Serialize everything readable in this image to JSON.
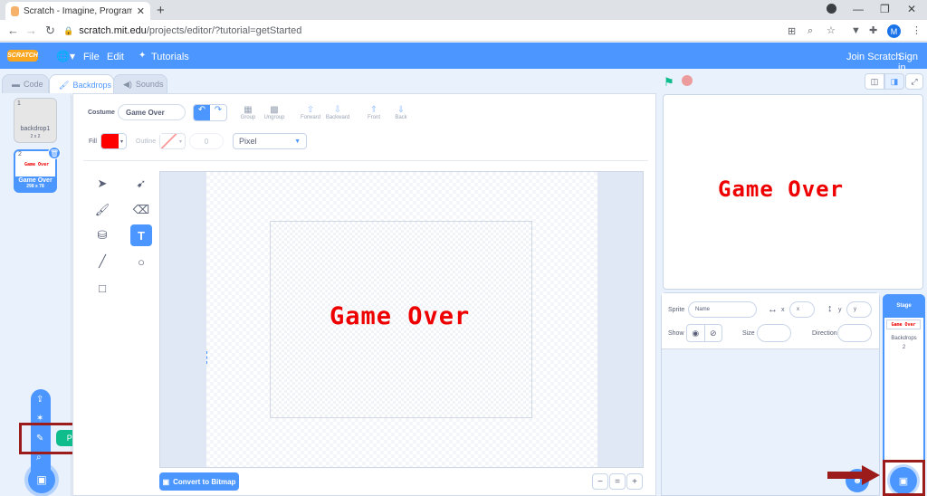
{
  "browser": {
    "tab_title": "Scratch - Imagine, Program, Shar",
    "tab_close": "✕",
    "new_tab": "+",
    "url_host": "scratch.mit.edu",
    "url_path": "/projects/editor/?tutorial=getStarted",
    "profile_initial": "M",
    "win_min": "—",
    "win_max": "❐",
    "win_close": "✕"
  },
  "menubar": {
    "logo": "SCRATCH",
    "file": "File",
    "edit": "Edit",
    "tutorials": "Tutorials",
    "join": "Join Scratch",
    "signin": "Sign in"
  },
  "editor_tabs": {
    "code": "Code",
    "backdrops": "Backdrops",
    "sounds": "Sounds"
  },
  "backdrops": [
    {
      "num": "1",
      "name": "backdrop1",
      "size": "2 x 2"
    },
    {
      "num": "2",
      "name": "Game Over",
      "size": "298 x 78",
      "thumb_text": "Game Over"
    }
  ],
  "add_menu": {
    "paint_tooltip": "Paint"
  },
  "paint_editor": {
    "costume_label": "Costume",
    "costume_name": "Game Over",
    "group": "Group",
    "ungroup": "Ungroup",
    "forward": "Forward",
    "backward": "Backward",
    "front": "Front",
    "back": "Back",
    "fill_label": "Fill",
    "outline_label": "Outline",
    "outline_value": "0",
    "font": "Pixel",
    "canvas_text": "Game Over",
    "convert_button": "Convert to Bitmap",
    "zoom_out": "−",
    "zoom_reset": "=",
    "zoom_in": "+"
  },
  "stage": {
    "text": "Game Over"
  },
  "sprite_info": {
    "sprite_label": "Sprite",
    "name_placeholder": "Name",
    "x_label": "x",
    "x_placeholder": "x",
    "y_label": "y",
    "y_placeholder": "y",
    "show_label": "Show",
    "size_label": "Size",
    "direction_label": "Direction"
  },
  "stage_pane": {
    "title": "Stage",
    "thumb_text": "Game Over",
    "backdrops_label": "Backdrops",
    "backdrops_count": "2"
  },
  "colors": {
    "scratch_blue": "#4c97ff",
    "fill_red": "#ff0000",
    "text_red": "#ee0000",
    "paint_green": "#0fbd8c",
    "highlight": "#9c1c1c"
  }
}
